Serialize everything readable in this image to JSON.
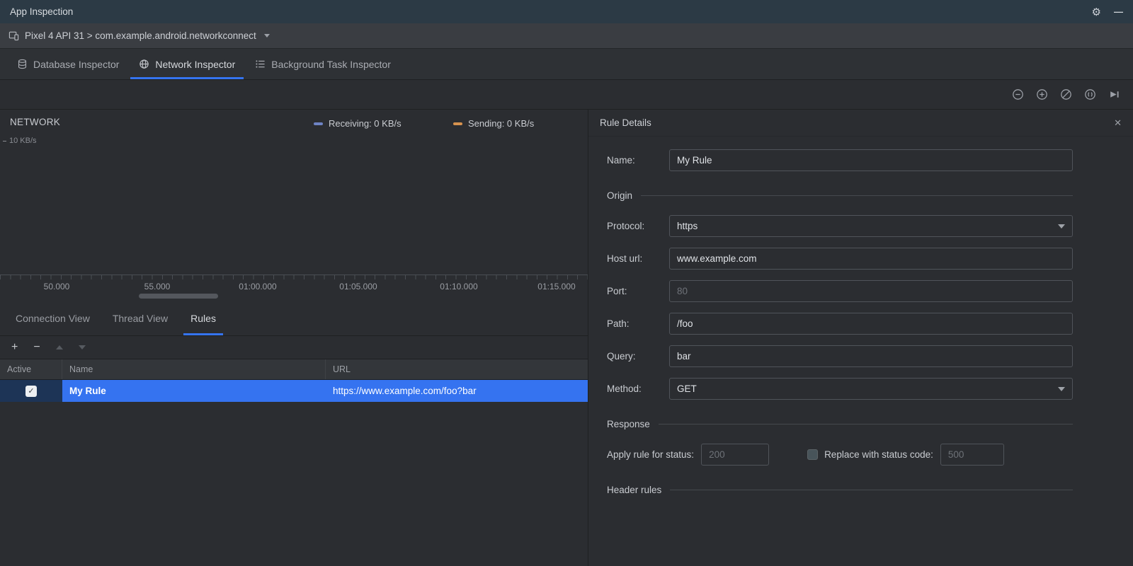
{
  "window": {
    "title": "App Inspection"
  },
  "icons": {
    "gear": "⚙",
    "minimize": "—",
    "close": "✕",
    "check": "✓",
    "plus": "+",
    "minus": "−"
  },
  "process_bar": {
    "label": "Pixel 4 API 31 > com.example.android.networkconnect"
  },
  "inspector_tabs": {
    "database": "Database Inspector",
    "network": "Network Inspector",
    "background": "Background Task Inspector"
  },
  "main_toolbar": {
    "icon_names": [
      "zoom-out",
      "zoom-in",
      "reset-zoom",
      "zoom-to-selection",
      "jump-to-live"
    ]
  },
  "chart": {
    "title": "NETWORK",
    "y_axis_label": "10 KB/s",
    "legend": {
      "receiving": {
        "label": "Receiving: 0 KB/s",
        "color": "#6E83C4"
      },
      "sending": {
        "label": "Sending: 0 KB/s",
        "color": "#D6924F"
      }
    },
    "x_ticks": [
      "50.000",
      "55.000",
      "01:00.000",
      "01:05.000",
      "01:10.000",
      "01:15.000"
    ]
  },
  "view_tabs": {
    "connection": "Connection View",
    "thread": "Thread View",
    "rules": "Rules"
  },
  "rules_table": {
    "columns": {
      "active": "Active",
      "name": "Name",
      "url": "URL"
    },
    "row": {
      "active": true,
      "name": "My Rule",
      "url": "https://www.example.com/foo?bar"
    }
  },
  "rule_details": {
    "title": "Rule Details",
    "name": {
      "label": "Name:",
      "value": "My Rule"
    },
    "origin_section": "Origin",
    "protocol": {
      "label": "Protocol:",
      "value": "https"
    },
    "host": {
      "label": "Host url:",
      "value": "www.example.com"
    },
    "port": {
      "label": "Port:",
      "placeholder": "80"
    },
    "path": {
      "label": "Path:",
      "value": "/foo"
    },
    "query": {
      "label": "Query:",
      "value": "bar"
    },
    "method": {
      "label": "Method:",
      "value": "GET"
    },
    "response_section": "Response",
    "status": {
      "apply_label": "Apply rule for status:",
      "apply_placeholder": "200",
      "replace_label": "Replace with status code:",
      "replace_placeholder": "500"
    },
    "header_section": "Header rules",
    "accent_color": "#3574F0",
    "selection_color": "#3573F0"
  }
}
